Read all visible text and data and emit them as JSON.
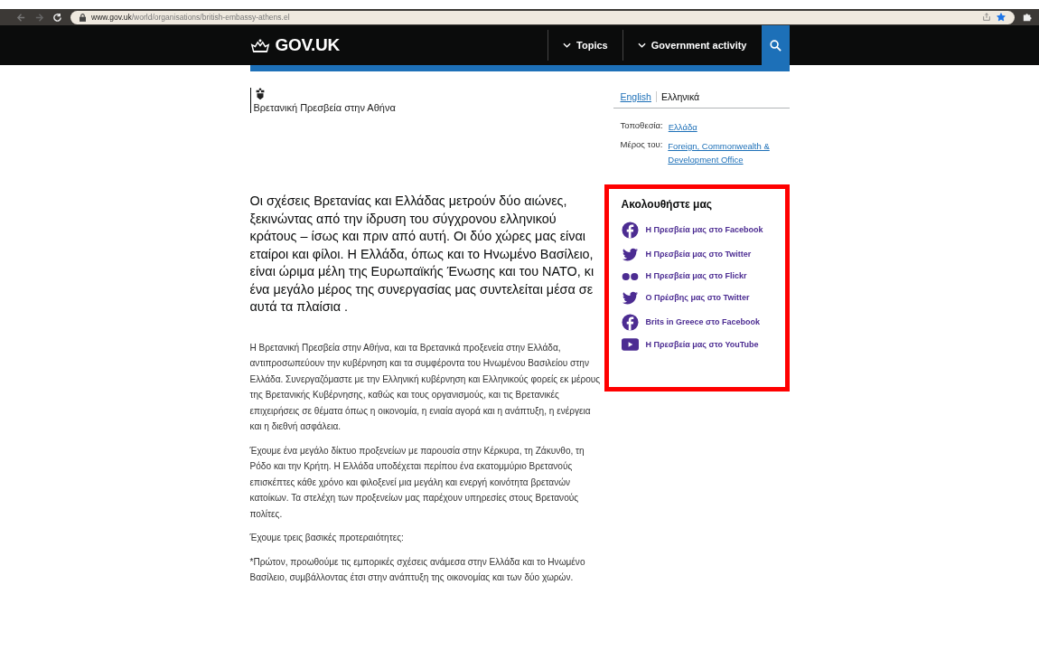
{
  "browser": {
    "url_host": "www.gov.uk",
    "url_path": "/world/organisations/british-embassy-athens.el",
    "bookmarked": true
  },
  "header": {
    "logo": "GOV.UK",
    "nav": [
      {
        "label": "Topics"
      },
      {
        "label": "Government activity"
      }
    ]
  },
  "organisation": {
    "name": "Βρετανική Πρεσβεία στην Αθήνα"
  },
  "languages": [
    {
      "label": "English",
      "selected": false
    },
    {
      "label": "Ελληνικά",
      "selected": true
    }
  ],
  "meta": [
    {
      "label": "Τοποθεσία:",
      "links": [
        "Ελλάδα"
      ]
    },
    {
      "label": "Μέρος του:",
      "links": [
        "Foreign, Commonwealth & Development Office"
      ]
    }
  ],
  "lead": "Οι σχέσεις Βρετανίας και Ελλάδας μετρούν δύο αιώνες, ξεκινώντας από την ίδρυση του σύγχρονου ελληνικού κράτους – ίσως και πριν από αυτή. Οι δύο χώρες μας είναι εταίροι και φίλοι. Η Ελλάδα, όπως και το Ηνωμένο Βασίλειο, είναι ώριμα μέλη της Ευρωπαϊκής Ένωσης και του ΝΑΤΟ, κι ένα μεγάλο μέρος της συνεργασίας μας συντελείται μέσα σε αυτά τα πλαίσια .",
  "paragraphs": [
    "Η Βρετανική Πρεσβεία στην Αθήνα, και τα Βρετανικά προξενεία στην Ελλάδα, αντιπροσωπεύουν την κυβέρνηση και τα συμφέροντα του Ηνωμένου Βασιλείου στην Ελλάδα. Συνεργαζόμαστε με την Ελληνική κυβέρνηση και Ελληνικούς φορείς εκ μέρους της Βρετανικής Κυβέρνησης, καθώς και τους οργανισμούς, και τις Βρετανικές επιχειρήσεις σε θέματα όπως η οικονομία, η ενιαία αγορά και η ανάπτυξη, η ενέργεια και η διεθνή ασφάλεια.",
    "Έχουμε ένα μεγάλο δίκτυο προξενείων με παρουσία στην Κέρκυρα, τη Ζάκυνθο, τη Ρόδο και την Κρήτη. Η Ελλάδα υποδέχεται περίπου ένα εκατομμύριο Βρετανούς επισκέπτες κάθε χρόνο και φιλοξενεί μια μεγάλη και ενεργή κοινότητα βρετανών κατοίκων. Τα στελέχη των προξενείων μας παρέχουν υπηρεσίες στους Βρετανούς πολίτες.",
    "Έχουμε τρεις βασικές προτεραιότητες:",
    "*Πρώτον, προωθούμε τις εμπορικές σχέσεις ανάμεσα στην Ελλάδα και το Ηνωμένο Βασίλειο, συμβάλλοντας έτσι στην ανάπτυξη της οικονομίας και των δύο χωρών."
  ],
  "follow": {
    "title": "Ακολουθήστε μας",
    "highlighted": true,
    "links": [
      {
        "kind": "facebook",
        "label": "Η Πρεσβεία μας στο Facebook"
      },
      {
        "kind": "twitter",
        "label": "Η Πρεσβεία μας στο Twitter"
      },
      {
        "kind": "flickr",
        "label": "Η Πρεσβεία μας στο Flickr"
      },
      {
        "kind": "twitter",
        "label": "Ο Πρέσβης μας στο Twitter"
      },
      {
        "kind": "facebook",
        "label": "Brits in Greece στο Facebook"
      },
      {
        "kind": "youtube",
        "label": "Η Πρεσβεία μας στο YouTube"
      }
    ]
  }
}
